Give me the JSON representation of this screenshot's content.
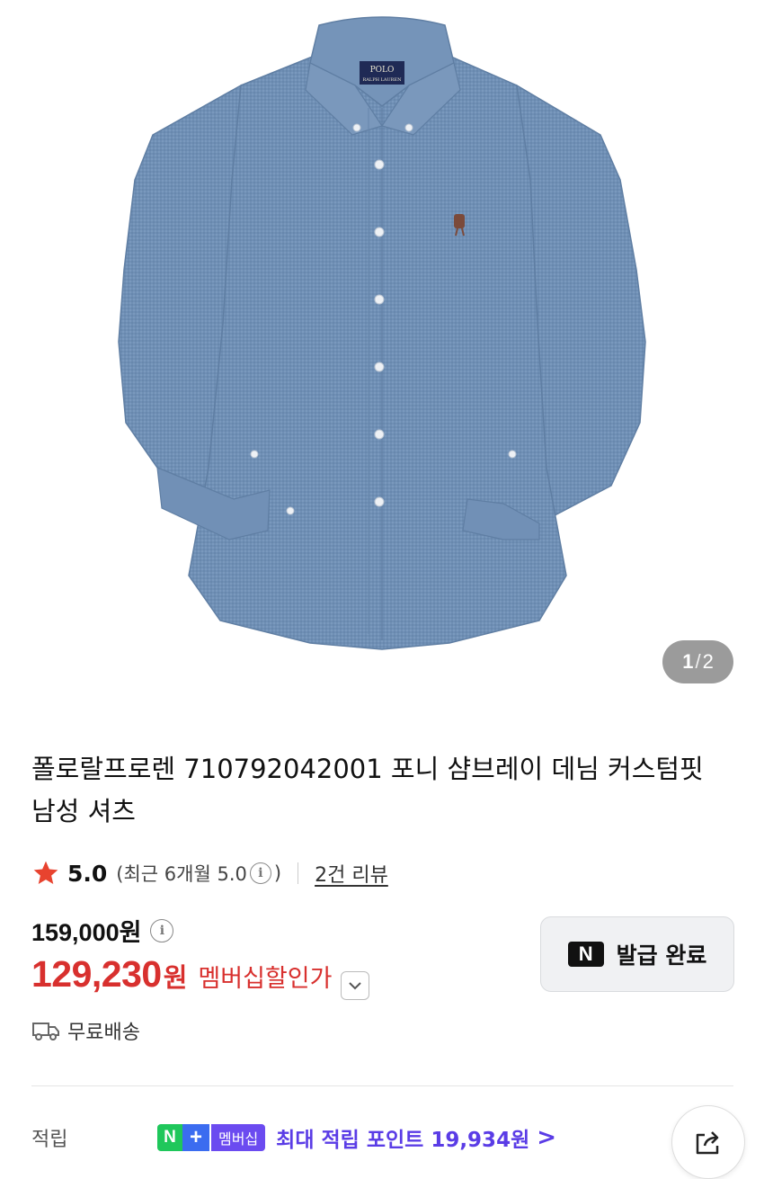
{
  "gallery": {
    "current": "1",
    "separator": "/",
    "total": "2",
    "image_icon": "shirt-product-image"
  },
  "product": {
    "title": "폴로랄프로렌 710792042001 포니 샴브레이 데님 커스텀핏 남성 셔츠",
    "label_brand_top": "POLO",
    "label_brand_bottom": "RALPH LAUREN"
  },
  "rating": {
    "score": "5.0",
    "recent_open": "(최근 6개월 5.0",
    "recent_close": ")",
    "review_link": "2건 리뷰",
    "star_color": "#e8432f"
  },
  "price": {
    "original": "159,000원",
    "sale": "129,230",
    "sale_unit": "원",
    "sale_label": "멤버십할인가",
    "sale_color": "#d8302e"
  },
  "coupon": {
    "badge": "N",
    "label": "발급 완료"
  },
  "shipping": {
    "label": "무료배송"
  },
  "points": {
    "label": "적립",
    "badge_n": "N",
    "badge_plus": "+",
    "badge_membership": "멤버십",
    "text": "최대 적립 포인트 19,934원",
    "chevron": ">",
    "color": "#5a3ce6"
  },
  "actions": {
    "share_icon": "share-icon"
  }
}
